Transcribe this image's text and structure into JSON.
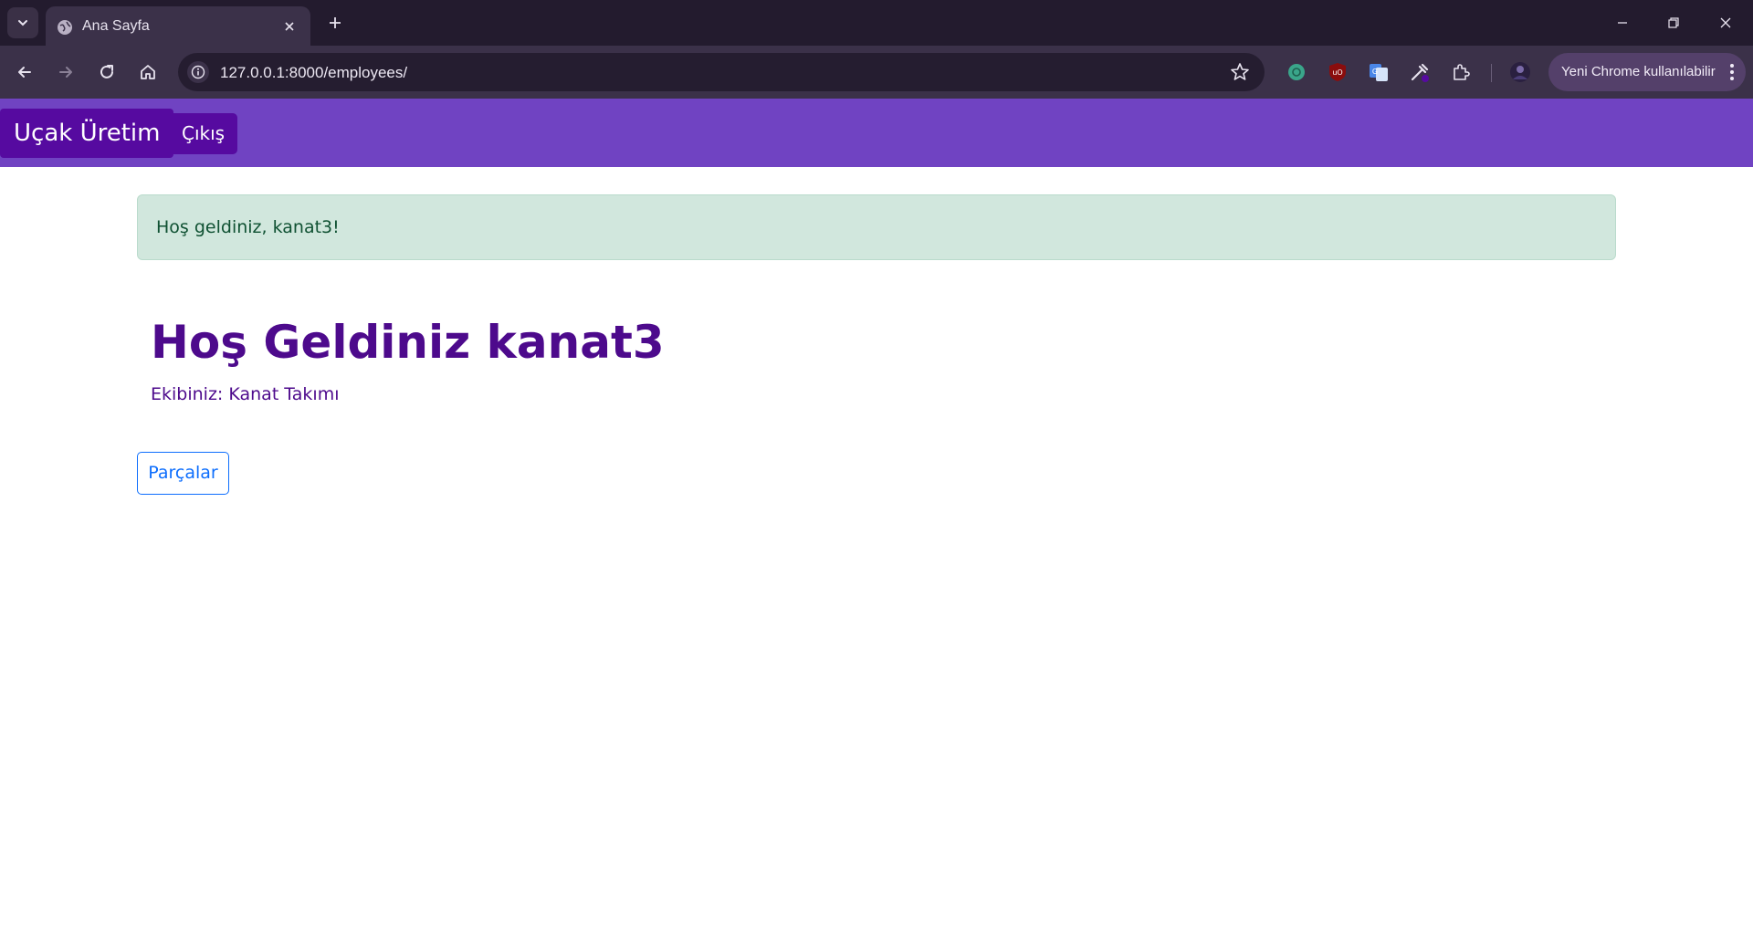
{
  "browser": {
    "tab": {
      "title": "Ana Sayfa"
    },
    "address_bar": {
      "url": "127.0.0.1:8000/employees/"
    },
    "profile_chip": {
      "label": "Yeni Chrome kullanılabilir"
    }
  },
  "app": {
    "navbar": {
      "brand": "Uçak Üretim",
      "logout_label": "Çıkış",
      "bg_color": "#7043c2",
      "button_color": "#560aa0"
    },
    "alert": {
      "message": "Hoş geldiniz, kanat3!"
    },
    "main": {
      "heading": "Hoş Geldiniz kanat3",
      "team_text": "Ekibiniz: Kanat Takımı",
      "parts_button": "Parçalar"
    }
  },
  "icons": [
    "tab-search-icon",
    "globe-icon",
    "close-icon",
    "plus-icon",
    "minimize-icon",
    "restore-icon",
    "back-icon",
    "forward-icon",
    "reload-icon",
    "home-icon",
    "info-icon",
    "star-icon",
    "chatgpt-icon",
    "ublock-icon",
    "google-translate-icon",
    "eyedropper-icon",
    "extensions-icon",
    "profile-avatar-icon",
    "more-vert-icon"
  ]
}
